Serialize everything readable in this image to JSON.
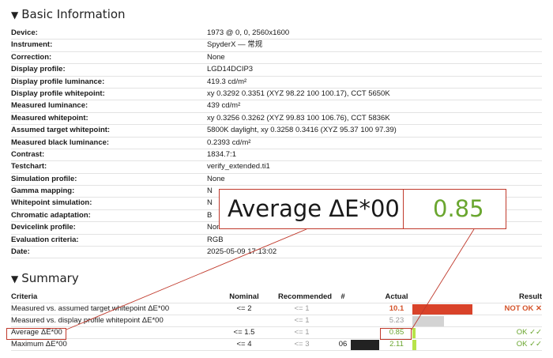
{
  "colors": {
    "accent_red": "#c0392b",
    "ok_green": "#6aa62f",
    "not_ok_orange": "#d4532a",
    "bar_red": "#d9432a",
    "bar_gray": "#d3d3d3",
    "bar_lime": "#b7e34a"
  },
  "basic": {
    "title": "Basic Information",
    "collapse_icon": "triangle-down-icon",
    "rows": [
      {
        "key": "Device:",
        "value": "1973 @ 0, 0, 2560x1600"
      },
      {
        "key": "Instrument:",
        "value": "SpyderX — 常规"
      },
      {
        "key": "Correction:",
        "value": "None"
      },
      {
        "key": "Display profile:",
        "value": "LGD14DCIP3"
      },
      {
        "key": "Display profile luminance:",
        "value": "419.3 cd/m²"
      },
      {
        "key": "Display profile whitepoint:",
        "value": "xy 0.3292 0.3351 (XYZ 98.22 100 100.17), CCT 5650K"
      },
      {
        "key": "Measured luminance:",
        "value": "439 cd/m²"
      },
      {
        "key": "Measured whitepoint:",
        "value": "xy 0.3256 0.3262 (XYZ 99.83 100 106.76), CCT 5836K"
      },
      {
        "key": "Assumed target whitepoint:",
        "value": "5800K daylight, xy 0.3258 0.3416 (XYZ 95.37 100 97.39)"
      },
      {
        "key": "Measured black luminance:",
        "value": "0.2393 cd/m²"
      },
      {
        "key": "Contrast:",
        "value": "1834.7:1"
      },
      {
        "key": "Testchart:",
        "value": "verify_extended.ti1"
      },
      {
        "key": "Simulation profile:",
        "value": "None"
      },
      {
        "key": "Gamma mapping:",
        "value": "N"
      },
      {
        "key": "Whitepoint simulation:",
        "value": "N"
      },
      {
        "key": "Chromatic adaptation:",
        "value": "B"
      },
      {
        "key": "Devicelink profile:",
        "value": "None"
      },
      {
        "key": "Evaluation criteria:",
        "value": "RGB"
      },
      {
        "key": "Date:",
        "value": "2025-05-09 17:13:02"
      }
    ]
  },
  "summary": {
    "title": "Summary",
    "collapse_icon": "triangle-down-icon",
    "headers": {
      "criteria": "Criteria",
      "nominal": "Nominal",
      "recommended": "Recommended",
      "hash": "#",
      "actual": "Actual",
      "result": "Result"
    },
    "rows": [
      {
        "criteria": "Measured vs. assumed target whitepoint ΔE*00",
        "nominal": "<= 2",
        "recommended": "<= 1",
        "hash": "",
        "actual": "10.1",
        "actual_color": "#d4532a",
        "bar_color": "#d9432a",
        "bar_fraction": 1.0,
        "result": "NOT OK ✕",
        "result_color": "#d4532a"
      },
      {
        "criteria": "Measured vs. display profile whitepoint ΔE*00",
        "nominal": "",
        "recommended": "<= 1",
        "hash": "",
        "actual": "5.23",
        "actual_color": "#9a9a9a",
        "bar_color": "#d3d3d3",
        "bar_fraction": 0.52,
        "result": "",
        "result_color": "#6aa62f"
      },
      {
        "criteria": "Average ΔE*00",
        "nominal": "<= 1.5",
        "recommended": "<= 1",
        "hash": "",
        "actual": "0.85",
        "actual_color": "#6aa62f",
        "bar_color": "#b7e34a",
        "bar_fraction": 0.03,
        "result": "OK ✓✓",
        "result_color": "#6aa62f"
      },
      {
        "criteria": "Maximum ΔE*00",
        "nominal": "<= 4",
        "recommended": "<= 3",
        "hash": "06",
        "actual": "2.11",
        "actual_color": "#6aa62f",
        "bar_color": "#b7e34a",
        "bar_fraction": 0.06,
        "result": "OK ✓✓",
        "result_color": "#6aa62f"
      }
    ]
  },
  "zoom": {
    "label": "Average ΔE*00",
    "value": "0.85",
    "value_color": "#6aa62f"
  }
}
